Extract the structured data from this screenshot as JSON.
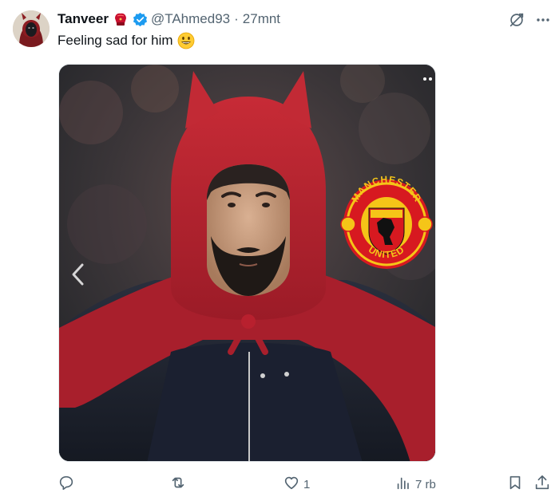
{
  "user": {
    "name": "Tanveer",
    "handle": "@TAhmed93",
    "separator": "·",
    "time": "27mnt"
  },
  "tweet": {
    "text": "Feeling sad for him"
  },
  "media": {
    "crest_top_text": "MANCHESTER",
    "crest_bottom_text": "UNITED"
  },
  "actions": {
    "reply_count": "",
    "retweet_count": "",
    "like_count": "1",
    "views_count": "7 rb"
  },
  "colors": {
    "text_primary": "#0f1419",
    "text_secondary": "#536471",
    "verified_blue": "#1d9bf0",
    "hood_red": "#b8202e",
    "crest_red": "#d71920",
    "crest_yellow": "#f5c518"
  },
  "icons": [
    "boxing-glove-icon",
    "verified-badge-icon",
    "grok-icon",
    "more-icon",
    "smiley-emoji-icon",
    "chevron-left-icon",
    "reply-icon",
    "retweet-icon",
    "heart-icon",
    "views-icon",
    "bookmark-icon",
    "share-icon"
  ]
}
